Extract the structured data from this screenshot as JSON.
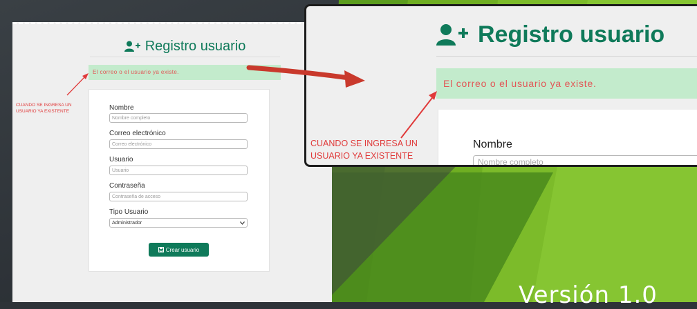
{
  "form": {
    "title": "Registro usuario",
    "alert": "El correo o el usuario ya existe.",
    "fields": [
      {
        "label": "Nombre",
        "placeholder": "Nombre completo"
      },
      {
        "label": "Correo electrónico",
        "placeholder": "Correo electrónico"
      },
      {
        "label": "Usuario",
        "placeholder": "Usuario"
      },
      {
        "label": "Contraseña",
        "placeholder": "Contraseña de acceso"
      }
    ],
    "tipo": {
      "label": "Tipo Usuario",
      "selected": "Administrador"
    },
    "submit_label": "Crear usuario"
  },
  "annotation": {
    "line1": "CUANDO SE INGRESA UN",
    "line2": "USUARIO YA EXISTENTE"
  },
  "zoom": {
    "title": "Registro usuario",
    "alert": "El correo o el usuario ya existe.",
    "field_label": "Nombre",
    "field_placeholder": "Nombre completo"
  },
  "slide": {
    "version": "Versión 1.0"
  },
  "colors": {
    "brand_green": "#0f7a5a",
    "alert_bg": "#c3ebcc",
    "alert_text": "#e25656",
    "annotation_red": "#e03a3a",
    "arrow_red": "#c9392c"
  },
  "icons": {
    "title_icon": "user-plus-icon",
    "button_icon": "save-icon",
    "select_icon": "chevron-down-icon"
  }
}
